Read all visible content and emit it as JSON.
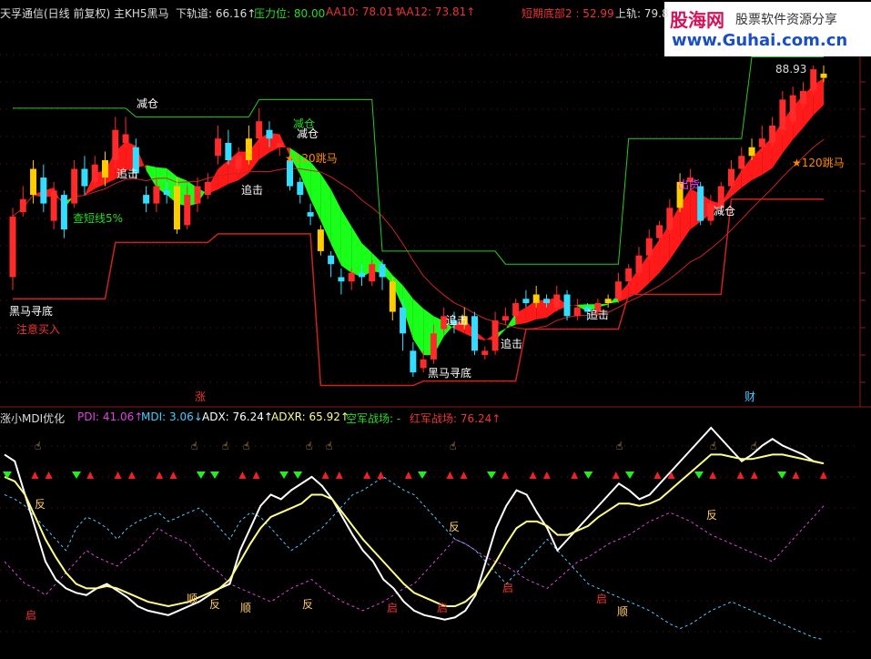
{
  "watermark": {
    "brand": "股海网",
    "slogan": "股票软件资源分享",
    "url": "www.Guhai.com.cn"
  },
  "top_header": [
    {
      "text": "天孚通信(日线 前复权) 主KH5黑马",
      "color": "#dcdcdc"
    },
    {
      "text": "下轨道: 66.16↑",
      "color": "#dcdcdc"
    },
    {
      "text": "压力位: 80.00",
      "color": "#22dd22"
    },
    {
      "text": "AA10: 78.01↑",
      "color": "#ee3333"
    },
    {
      "text": "AA12: 73.81↑",
      "color": "#ee3333"
    },
    {
      "text": "短期底部2 : 52.99",
      "color": "#ee3333"
    },
    {
      "text": "上轨: 79.8",
      "color": "#dcdcdc"
    }
  ],
  "bottom_header": [
    {
      "text": "涨小MDI优化",
      "color": "#dcdcdc"
    },
    {
      "text": "PDI: 41.06↑",
      "color": "#dd44dd"
    },
    {
      "text": "MDI: 3.06↓",
      "color": "#44ccff"
    },
    {
      "text": "ADX: 76.24↑",
      "color": "#ffffff"
    },
    {
      "text": "ADXR: 65.92↑",
      "color": "#ffff88"
    },
    {
      "text": "空军战场: -",
      "color": "#22dd22"
    },
    {
      "text": "红军战场: 76.24↑",
      "color": "#ee3333"
    }
  ],
  "chart_data": [
    {
      "type": "candlestick",
      "price_range": [
        52.99,
        88.93
      ],
      "grid": "dotted",
      "candles": [
        {
          "x": "1",
          "o": 64.5,
          "c": 71.5,
          "h": 72.5,
          "l": 63.0
        },
        {
          "x": "2",
          "o": 72.0,
          "c": 73.5,
          "h": 75.0,
          "l": 71.5
        },
        {
          "x": "3",
          "o": 74.0,
          "c": 77.0,
          "h": 78.0,
          "l": 73.0
        },
        {
          "x": "4",
          "o": 76.0,
          "c": 73.0,
          "h": 77.5,
          "l": 72.0
        },
        {
          "x": "5",
          "o": 71.0,
          "c": 74.5,
          "h": 75.5,
          "l": 70.0
        },
        {
          "x": "6",
          "o": 74.0,
          "c": 70.0,
          "h": 74.5,
          "l": 69.0
        },
        {
          "x": "7",
          "o": 73.0,
          "c": 77.0,
          "h": 78.0,
          "l": 72.5
        },
        {
          "x": "8",
          "o": 77.0,
          "c": 75.0,
          "h": 78.5,
          "l": 74.0
        },
        {
          "x": "9",
          "o": 75.5,
          "c": 77.5,
          "h": 78.5,
          "l": 75.0
        },
        {
          "x": "10",
          "o": 76.0,
          "c": 78.0,
          "h": 79.0,
          "l": 75.0
        },
        {
          "x": "11",
          "o": 78.0,
          "c": 81.5,
          "h": 83.0,
          "l": 77.0
        },
        {
          "x": "12",
          "o": 80.0,
          "c": 81.0,
          "h": 83.0,
          "l": 79.5
        },
        {
          "x": "13",
          "o": 79.5,
          "c": 76.5,
          "h": 80.5,
          "l": 76.0
        },
        {
          "x": "14",
          "o": 74.0,
          "c": 73.0,
          "h": 75.0,
          "l": 72.0
        },
        {
          "x": "15",
          "o": 73.0,
          "c": 75.0,
          "h": 76.0,
          "l": 72.0
        },
        {
          "x": "16",
          "o": 74.5,
          "c": 74.0,
          "h": 75.5,
          "l": 73.0
        },
        {
          "x": "17",
          "o": 75.0,
          "c": 70.0,
          "h": 76.0,
          "l": 69.5
        },
        {
          "x": "18",
          "o": 70.5,
          "c": 74.0,
          "h": 75.0,
          "l": 70.0
        },
        {
          "x": "19",
          "o": 73.0,
          "c": 75.0,
          "h": 76.0,
          "l": 72.0
        },
        {
          "x": "20",
          "o": 74.0,
          "c": 75.5,
          "h": 76.5,
          "l": 73.5
        },
        {
          "x": "21",
          "o": 78.5,
          "c": 80.5,
          "h": 82.0,
          "l": 77.5
        },
        {
          "x": "22",
          "o": 80.0,
          "c": 78.0,
          "h": 81.5,
          "l": 77.5
        },
        {
          "x": "23",
          "o": 77.0,
          "c": 78.5,
          "h": 79.5,
          "l": 76.5
        },
        {
          "x": "24",
          "o": 78.0,
          "c": 80.5,
          "h": 82.0,
          "l": 77.5
        },
        {
          "x": "25",
          "o": 80.5,
          "c": 82.5,
          "h": 84.0,
          "l": 80.0
        },
        {
          "x": "26",
          "o": 81.5,
          "c": 80.5,
          "h": 82.5,
          "l": 79.5
        },
        {
          "x": "27",
          "o": 79.5,
          "c": 80.0,
          "h": 81.0,
          "l": 78.5
        },
        {
          "x": "28",
          "o": 78.0,
          "c": 75.0,
          "h": 78.5,
          "l": 74.5
        },
        {
          "x": "29",
          "o": 75.5,
          "c": 74.0,
          "h": 76.0,
          "l": 73.0
        },
        {
          "x": "30",
          "o": 72.0,
          "c": 71.5,
          "h": 73.0,
          "l": 70.5
        },
        {
          "x": "31",
          "o": 70.0,
          "c": 67.5,
          "h": 70.5,
          "l": 67.0
        },
        {
          "x": "32",
          "o": 67.0,
          "c": 66.0,
          "h": 67.5,
          "l": 64.5
        },
        {
          "x": "33",
          "o": 64.5,
          "c": 64.0,
          "h": 65.5,
          "l": 62.5
        },
        {
          "x": "34",
          "o": 64.0,
          "c": 65.0,
          "h": 65.5,
          "l": 63.0
        },
        {
          "x": "35",
          "o": 65.0,
          "c": 64.5,
          "h": 66.0,
          "l": 63.5
        },
        {
          "x": "36",
          "o": 64.0,
          "c": 66.0,
          "h": 66.5,
          "l": 63.5
        },
        {
          "x": "37",
          "o": 66.0,
          "c": 64.5,
          "h": 66.5,
          "l": 63.0
        },
        {
          "x": "38",
          "o": 64.0,
          "c": 60.5,
          "h": 64.5,
          "l": 59.5
        },
        {
          "x": "39",
          "o": 61.0,
          "c": 58.0,
          "h": 62.0,
          "l": 56.0
        },
        {
          "x": "40",
          "o": 56.0,
          "c": 53.5,
          "h": 57.0,
          "l": 52.99
        },
        {
          "x": "41",
          "o": 54.0,
          "c": 55.0,
          "h": 56.0,
          "l": 53.5
        },
        {
          "x": "42",
          "o": 55.0,
          "c": 58.0,
          "h": 59.0,
          "l": 54.5
        },
        {
          "x": "43",
          "o": 58.5,
          "c": 60.0,
          "h": 61.0,
          "l": 58.0
        },
        {
          "x": "44",
          "o": 59.5,
          "c": 59.0,
          "h": 60.5,
          "l": 58.0
        },
        {
          "x": "45",
          "o": 59.0,
          "c": 60.0,
          "h": 61.0,
          "l": 58.5
        },
        {
          "x": "46",
          "o": 60.0,
          "c": 56.0,
          "h": 60.5,
          "l": 55.5
        },
        {
          "x": "47",
          "o": 55.5,
          "c": 56.0,
          "h": 56.5,
          "l": 55.0
        },
        {
          "x": "48",
          "o": 56.0,
          "c": 59.5,
          "h": 60.5,
          "l": 55.5
        },
        {
          "x": "49",
          "o": 59.5,
          "c": 60.0,
          "h": 61.0,
          "l": 59.0
        },
        {
          "x": "50",
          "o": 60.0,
          "c": 61.5,
          "h": 62.0,
          "l": 59.5
        },
        {
          "x": "51",
          "o": 62.0,
          "c": 61.5,
          "h": 63.0,
          "l": 61.0
        },
        {
          "x": "52",
          "o": 61.5,
          "c": 62.5,
          "h": 63.5,
          "l": 61.0
        },
        {
          "x": "53",
          "o": 62.0,
          "c": 61.5,
          "h": 62.5,
          "l": 61.0
        },
        {
          "x": "54",
          "o": 61.0,
          "c": 62.5,
          "h": 63.5,
          "l": 60.5
        },
        {
          "x": "55",
          "o": 62.5,
          "c": 60.0,
          "h": 63.0,
          "l": 59.5
        },
        {
          "x": "56",
          "o": 60.0,
          "c": 61.0,
          "h": 62.0,
          "l": 59.5
        },
        {
          "x": "57",
          "o": 61.0,
          "c": 60.5,
          "h": 61.5,
          "l": 59.5
        },
        {
          "x": "58",
          "o": 60.5,
          "c": 61.5,
          "h": 62.0,
          "l": 60.0
        },
        {
          "x": "59",
          "o": 61.5,
          "c": 62.0,
          "h": 62.5,
          "l": 61.0
        },
        {
          "x": "60",
          "o": 62.0,
          "c": 64.0,
          "h": 65.0,
          "l": 61.5
        },
        {
          "x": "61",
          "o": 64.0,
          "c": 65.5,
          "h": 66.0,
          "l": 63.5
        },
        {
          "x": "62",
          "o": 65.0,
          "c": 67.0,
          "h": 68.0,
          "l": 64.5
        },
        {
          "x": "63",
          "o": 67.0,
          "c": 69.0,
          "h": 70.0,
          "l": 66.5
        },
        {
          "x": "64",
          "o": 69.0,
          "c": 70.5,
          "h": 71.0,
          "l": 68.5
        },
        {
          "x": "65",
          "o": 70.0,
          "c": 72.5,
          "h": 73.5,
          "l": 69.5
        },
        {
          "x": "66",
          "o": 72.5,
          "c": 75.5,
          "h": 76.5,
          "l": 72.0
        },
        {
          "x": "67",
          "o": 75.5,
          "c": 76.0,
          "h": 77.0,
          "l": 74.5
        },
        {
          "x": "68",
          "o": 75.0,
          "c": 71.0,
          "h": 75.5,
          "l": 70.5
        },
        {
          "x": "69",
          "o": 71.0,
          "c": 73.0,
          "h": 74.0,
          "l": 70.5
        },
        {
          "x": "70",
          "o": 72.5,
          "c": 75.0,
          "h": 75.5,
          "l": 72.0
        },
        {
          "x": "71",
          "o": 75.0,
          "c": 77.0,
          "h": 78.0,
          "l": 74.5
        },
        {
          "x": "72",
          "o": 77.0,
          "c": 78.5,
          "h": 79.5,
          "l": 76.5
        },
        {
          "x": "73",
          "o": 78.5,
          "c": 79.5,
          "h": 80.5,
          "l": 78.0
        },
        {
          "x": "74",
          "o": 79.5,
          "c": 80.5,
          "h": 82.0,
          "l": 79.0
        },
        {
          "x": "75",
          "o": 80.0,
          "c": 82.0,
          "h": 83.0,
          "l": 79.5
        },
        {
          "x": "76",
          "o": 81.5,
          "c": 85.0,
          "h": 86.0,
          "l": 81.0
        },
        {
          "x": "77",
          "o": 82.5,
          "c": 85.5,
          "h": 86.5,
          "l": 82.0
        },
        {
          "x": "78",
          "o": 84.5,
          "c": 86.0,
          "h": 87.0,
          "l": 84.0
        },
        {
          "x": "79",
          "o": 86.0,
          "c": 88.5,
          "h": 88.93,
          "l": 85.5
        },
        {
          "x": "80",
          "o": 87.5,
          "c": 88.0,
          "h": 88.93,
          "l": 87.0
        }
      ],
      "annotations": [
        {
          "text": "黑马寻底",
          "color": "#ffffff"
        },
        {
          "text": "注意买入",
          "color": "#ee3333"
        },
        {
          "text": "追击",
          "color": "#ffffff"
        },
        {
          "text": "减仓",
          "color": "#ffffff"
        },
        {
          "text": "查短线5%",
          "color": "#22dd22"
        },
        {
          "text": "追击",
          "color": "#ffffff"
        },
        {
          "text": "减仓",
          "color": "#22dd22"
        },
        {
          "text": "减仓",
          "color": "#ffffff"
        },
        {
          "text": "★120跳马",
          "color": "#ff8800"
        },
        {
          "text": "追击",
          "color": "#ffffff"
        },
        {
          "text": "黑马寻底",
          "color": "#ffffff"
        },
        {
          "text": "追击",
          "color": "#ffffff"
        },
        {
          "text": "追击",
          "color": "#ffffff"
        },
        {
          "text": "出货",
          "color": "#ff44ff"
        },
        {
          "text": "减仓",
          "color": "#ffffff"
        },
        {
          "text": "★120跳马",
          "color": "#ff8800"
        },
        {
          "text": "88.93",
          "color": "#dcdcdc"
        },
        {
          "text": "涨",
          "color": "#ee3333"
        },
        {
          "text": "财",
          "color": "#44ccff"
        }
      ]
    },
    {
      "type": "line",
      "title": "涨小MDI优化",
      "series": [
        {
          "name": "PDI",
          "color": "#dd44dd",
          "dashed": true,
          "values": [
            40,
            35,
            30,
            28,
            25,
            30,
            35,
            40,
            45,
            42,
            40,
            38,
            42,
            45,
            50,
            55,
            52,
            50,
            48,
            42,
            38,
            35,
            30,
            28,
            26,
            24,
            22,
            25,
            28,
            30,
            32,
            28,
            25,
            22,
            20,
            18,
            20,
            22,
            25,
            28,
            30,
            35,
            40,
            45,
            50,
            48,
            45,
            42,
            40,
            38,
            35,
            32,
            30,
            28,
            32,
            36,
            40,
            42,
            45,
            48,
            50,
            52,
            55,
            58,
            60,
            62,
            60,
            58,
            55,
            52,
            50,
            48,
            46,
            44,
            42,
            40,
            45,
            50,
            55,
            60,
            65
          ]
        },
        {
          "name": "MDI",
          "color": "#44ccff",
          "dashed": true,
          "values": [
            70,
            68,
            65,
            60,
            55,
            50,
            45,
            55,
            60,
            58,
            55,
            50,
            55,
            58,
            60,
            62,
            58,
            60,
            62,
            64,
            60,
            55,
            50,
            58,
            62,
            60,
            55,
            50,
            45,
            48,
            52,
            55,
            60,
            65,
            70,
            72,
            75,
            78,
            75,
            72,
            70,
            65,
            60,
            55,
            50,
            48,
            45,
            40,
            35,
            30,
            35,
            40,
            45,
            50,
            45,
            40,
            35,
            30,
            28,
            26,
            24,
            22,
            20,
            18,
            15,
            12,
            10,
            12,
            15,
            18,
            20,
            22,
            20,
            18,
            16,
            14,
            12,
            10,
            8,
            6,
            5
          ]
        },
        {
          "name": "ADX",
          "color": "#ffffff",
          "values": [
            88,
            85,
            70,
            55,
            40,
            32,
            28,
            26,
            25,
            28,
            30,
            27,
            24,
            20,
            18,
            17,
            16,
            18,
            20,
            22,
            25,
            28,
            30,
            45,
            55,
            65,
            70,
            68,
            72,
            75,
            78,
            74,
            68,
            60,
            52,
            45,
            40,
            32,
            28,
            22,
            18,
            16,
            15,
            14,
            15,
            18,
            25,
            40,
            55,
            65,
            72,
            70,
            62,
            55,
            45,
            50,
            55,
            60,
            65,
            70,
            75,
            72,
            68,
            70,
            75,
            80,
            85,
            90,
            95,
            100,
            95,
            90,
            85,
            88,
            92,
            95,
            92,
            90,
            88,
            85,
            84
          ]
        },
        {
          "name": "ADXR",
          "color": "#ffff88",
          "values": [
            78,
            76,
            70,
            60,
            50,
            42,
            35,
            30,
            28,
            28,
            29,
            28,
            26,
            24,
            22,
            21,
            20,
            21,
            22,
            24,
            26,
            28,
            32,
            40,
            48,
            55,
            60,
            62,
            64,
            66,
            70,
            70,
            68,
            62,
            56,
            50,
            45,
            40,
            35,
            30,
            26,
            24,
            22,
            20,
            20,
            22,
            26,
            33,
            40,
            48,
            55,
            58,
            58,
            56,
            52,
            52,
            54,
            56,
            60,
            63,
            66,
            66,
            65,
            66,
            68,
            72,
            76,
            80,
            84,
            88,
            88,
            87,
            86,
            86,
            87,
            88,
            88,
            87,
            86,
            85,
            84
          ]
        }
      ],
      "markers": [
        "反",
        "反",
        "顺",
        "反",
        "顺",
        "反",
        "反",
        "启",
        "启",
        "启",
        "启",
        "启",
        "顺"
      ]
    }
  ]
}
